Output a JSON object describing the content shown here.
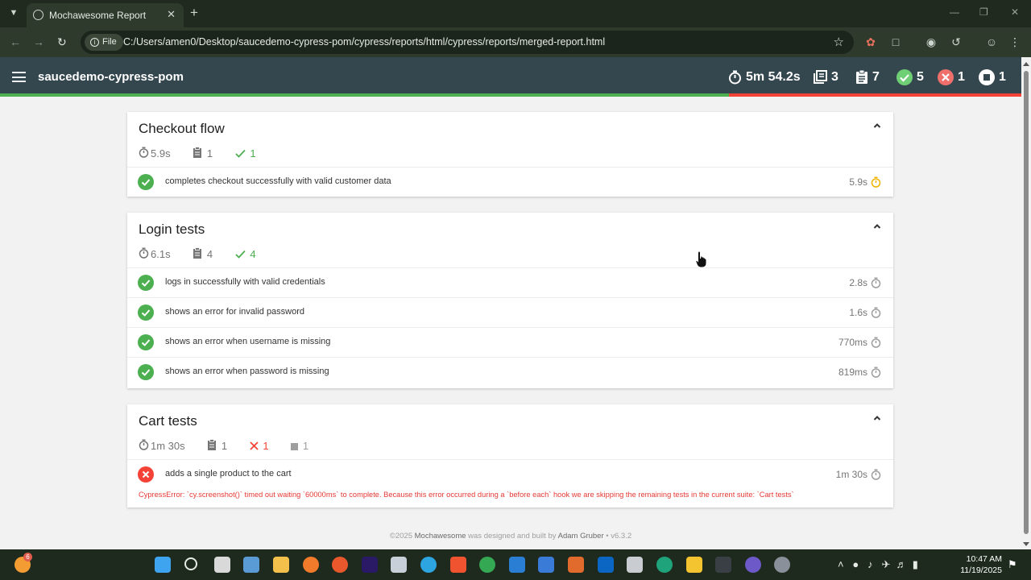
{
  "browser": {
    "tab_title": "Mochawesome Report",
    "new_tab_symbol": "+",
    "scheme_chip": "File",
    "url": "C:/Users/amen0/Desktop/saucedemo-cypress-pom/cypress/reports/html/cypress/reports/merged-report.html"
  },
  "report": {
    "title": "saucedemo-cypress-pom",
    "stats": {
      "duration": "5m 54.2s",
      "suites": "3",
      "tests": "7",
      "passes": "5",
      "failures": "1",
      "skipped": "1"
    },
    "progress": {
      "pass_fraction": 0.714,
      "fail_fraction": 0.286
    },
    "colors": {
      "pass": "#4caf50",
      "fail": "#f44336",
      "nav": "#34474f"
    }
  },
  "suites": [
    {
      "title": "Checkout flow",
      "duration": "5.9s",
      "tests": "1",
      "passes": "1",
      "items": [
        {
          "name": "completes checkout successfully with valid customer data",
          "duration": "5.9s",
          "state": "passed",
          "slow": true
        }
      ]
    },
    {
      "title": "Login tests",
      "duration": "6.1s",
      "tests": "4",
      "passes": "4",
      "items": [
        {
          "name": "logs in successfully with valid credentials",
          "duration": "2.8s",
          "state": "passed"
        },
        {
          "name": "shows an error for invalid password",
          "duration": "1.6s",
          "state": "passed"
        },
        {
          "name": "shows an error when username is missing",
          "duration": "770ms",
          "state": "passed"
        },
        {
          "name": "shows an error when password is missing",
          "duration": "819ms",
          "state": "passed"
        }
      ]
    },
    {
      "title": "Cart tests",
      "duration": "1m 30s",
      "tests": "1",
      "failures": "1",
      "skipped": "1",
      "items": [
        {
          "name": "adds a single product to the cart",
          "duration": "1m 30s",
          "state": "failed",
          "error": "CypressError: `cy.screenshot()` timed out waiting `60000ms` to complete. Because this error occurred during a `before each` hook we are skipping the remaining tests in the current suite: `Cart tests`"
        }
      ]
    }
  ],
  "footer": {
    "prefix": "©2025",
    "brand": "Mochawesome",
    "middle": "was designed and built by",
    "author": "Adam Gruber",
    "version": "• v6.3.2"
  },
  "taskbar": {
    "weather_badge": "6",
    "time": "10:47 AM",
    "date": "11/19/2025"
  }
}
